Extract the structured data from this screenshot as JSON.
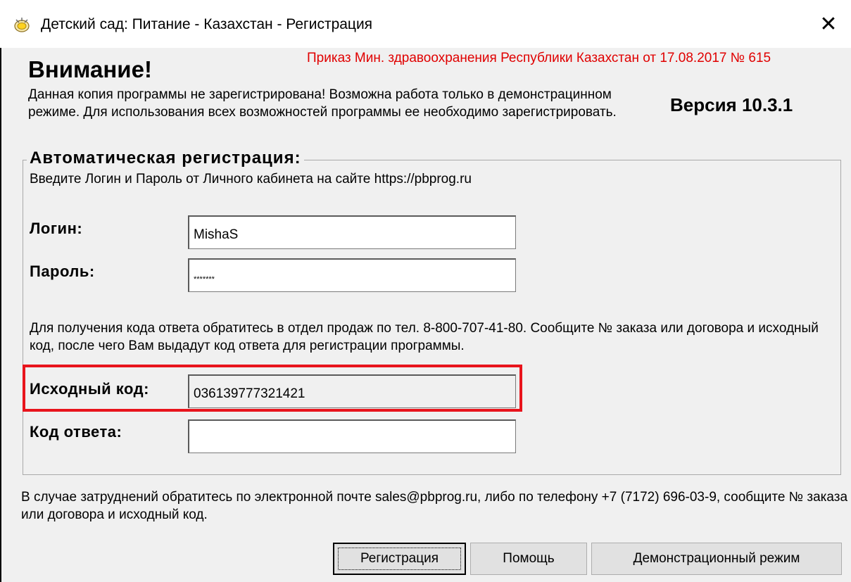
{
  "window": {
    "title": "Детский сад: Питание - Казахстан - Регистрация",
    "close_glyph": "✕"
  },
  "header": {
    "attention": "Внимание!",
    "order_reference": "Приказ Мин. здравоохранения Республики Казахстан от 17.08.2017 № 615",
    "version": "Версия 10.3.1",
    "warning": "Данная копия программы не зарегистрирована! Возможна работа только в демонстрацинном режиме. Для использования всех возможностей программы ее необходимо зарегистрировать."
  },
  "auto_registration": {
    "title": "Автоматическая регистрация:",
    "hint": "Введите Логин и Пароль от Личного кабинета на сайте https://pbprog.ru",
    "login_label": "Логин:",
    "login_value": "MishaS",
    "password_label": "Пароль:",
    "password_value": "*******",
    "info": "Для получения кода ответа обратитесь в отдел продаж по тел. 8-800-707-41-80. Сообщите № заказа или договора и исходный код, после чего Вам выдадут код ответа для регистрации программы.",
    "source_code_label": "Исходный код:",
    "source_code_value": "036139777321421",
    "response_code_label": "Код ответа:",
    "response_code_value": ""
  },
  "footer": {
    "contact": "В случае затруднений обратитесь по электронной почте sales@pbprog.ru, либо по телефону +7 (7172) 696-03-9, сообщите № заказа или договора и исходный код."
  },
  "buttons": {
    "register": "Регистрация",
    "help": "Помощь",
    "demo": "Демонстрационный режим"
  },
  "colors": {
    "accent_red": "#e8141c",
    "order_reference_red": "#e00000"
  }
}
